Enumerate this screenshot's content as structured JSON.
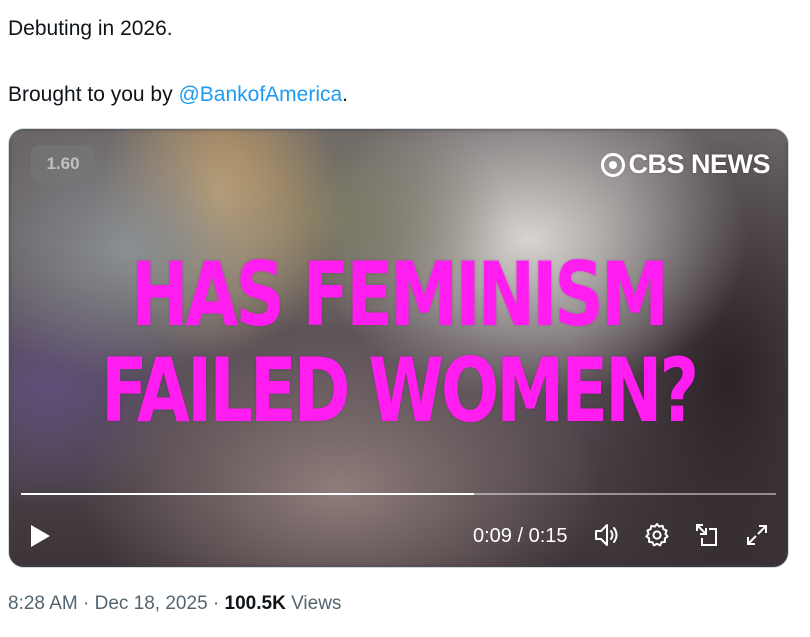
{
  "tweet": {
    "line1": "Debuting in 2026.",
    "line2_prefix": "Brought to you by ",
    "mention": "@BankofAmerica",
    "line2_suffix": "."
  },
  "video": {
    "playback_rate": "1.60",
    "network_logo_text": "CBS NEWS",
    "headline_line1": "HAS FEMINISM",
    "headline_line2": "FAILED WOMEN?",
    "headline_color": "#ff1df0",
    "time_display": "0:09 / 0:15",
    "progress_fraction": 0.6,
    "controls": {
      "play_icon": "play-icon",
      "volume_icon": "volume-icon",
      "settings_icon": "gear-icon",
      "dock_icon": "picture-in-picture-icon",
      "fullscreen_icon": "fullscreen-icon"
    }
  },
  "meta": {
    "time": "8:28 AM",
    "separator": " · ",
    "date": "Dec 18, 2025",
    "views_count": "100.5K",
    "views_label": " Views"
  },
  "colors": {
    "link": "#1d9bf0",
    "text": "#0f1419",
    "secondary": "#536471"
  }
}
